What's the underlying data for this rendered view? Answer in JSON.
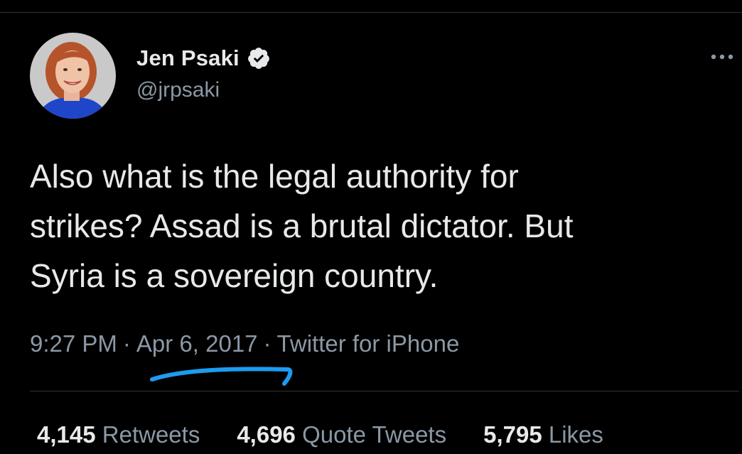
{
  "tweet": {
    "author": {
      "display_name": "Jen Psaki",
      "handle": "@jrpsaki",
      "verified": true
    },
    "text": "Also what is the legal authority for\nstrikes? Assad is a brutal dictator. But\nSyria is a sovereign country.",
    "time": "9:27 PM",
    "separator": "·",
    "date": "Apr 6, 2017",
    "source": "Twitter for iPhone",
    "stats": {
      "retweets_count": "4,145",
      "retweets_label": "Retweets",
      "quote_tweets_count": "4,696",
      "quote_tweets_label": "Quote Tweets",
      "likes_count": "5,795",
      "likes_label": "Likes"
    }
  },
  "icons": {
    "more": "more-horizontal-icon",
    "verified": "verified-badge-icon"
  },
  "colors": {
    "background": "#000000",
    "primary_text": "#e7e9ea",
    "secondary_text": "#8b98a5",
    "divider": "#2f3336",
    "annotation_underline": "#1d9bf0"
  }
}
